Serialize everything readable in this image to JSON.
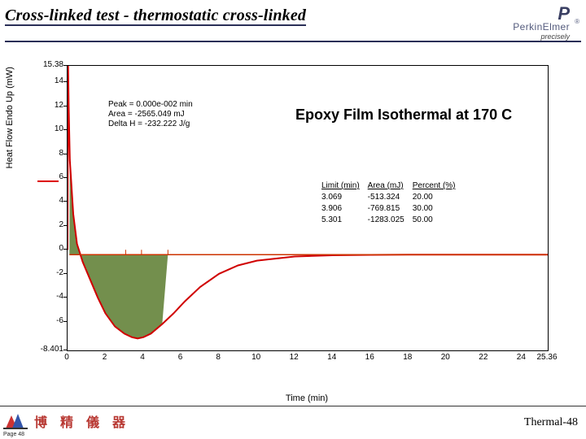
{
  "header": {
    "title": "Cross-linked test - thermostatic cross-linked",
    "brand_main": "PerkinElmer",
    "brand_tag": "precisely"
  },
  "chart_data": {
    "type": "line",
    "title": "Epoxy Film Isothermal at 170 C",
    "xlabel": "Time (min)",
    "ylabel": "Heat Flow Endo Up (mW)",
    "x_ticks": [
      0,
      2,
      4,
      6,
      8,
      10,
      12,
      14,
      16,
      18,
      20,
      22,
      24,
      25.36
    ],
    "y_ticks": [
      -8.401,
      -6,
      -4,
      -2,
      0,
      2,
      4,
      6,
      8,
      10,
      12,
      14,
      15.38
    ],
    "ylim": [
      -8.401,
      15.38
    ],
    "xlim": [
      0,
      25.36
    ],
    "peak_annotation": {
      "peak": "0.000e-002 min",
      "area": "-2565.049 mJ",
      "delta_h": "-232.222 J/g"
    },
    "limits_table": {
      "headers": [
        "Limit (min)",
        "Area (mJ)",
        "Percent (%)"
      ],
      "rows": [
        [
          "3.069",
          "-513.324",
          "20.00"
        ],
        [
          "3.906",
          "-769.815",
          "30.00"
        ],
        [
          "5.301",
          "-1283.025",
          "50.00"
        ]
      ]
    },
    "series": [
      {
        "name": "heat-flow",
        "color": "#d00000",
        "x": [
          0.0,
          0.03,
          0.06,
          0.12,
          0.3,
          0.5,
          0.8,
          1.2,
          1.6,
          2.0,
          2.5,
          3.0,
          3.4,
          3.7,
          4.0,
          4.4,
          5.0,
          5.6,
          6.2,
          7.0,
          8.0,
          9.0,
          10.0,
          12.0,
          14.0,
          16.0,
          18.0,
          20.0,
          22.0,
          24.0,
          25.36
        ],
        "y": [
          0.0,
          15.38,
          12.0,
          7.5,
          3.0,
          0.5,
          -1.0,
          -2.5,
          -4.0,
          -5.3,
          -6.4,
          -7.0,
          -7.3,
          -7.4,
          -7.3,
          -7.0,
          -6.2,
          -5.3,
          -4.3,
          -3.1,
          -2.0,
          -1.3,
          -0.9,
          -0.55,
          -0.45,
          -0.42,
          -0.4,
          -0.4,
          -0.4,
          -0.4,
          -0.4
        ]
      }
    ],
    "fill_region": {
      "color": "#5a7b2e",
      "x_range": [
        0.1,
        5.3
      ],
      "baseline_y": -0.4
    },
    "vertical_markers_x": [
      3.069,
      3.906,
      5.301
    ]
  },
  "footer": {
    "company": "博 精 儀 器",
    "page_label": "Thermal-48",
    "small_page": "Page 48"
  }
}
